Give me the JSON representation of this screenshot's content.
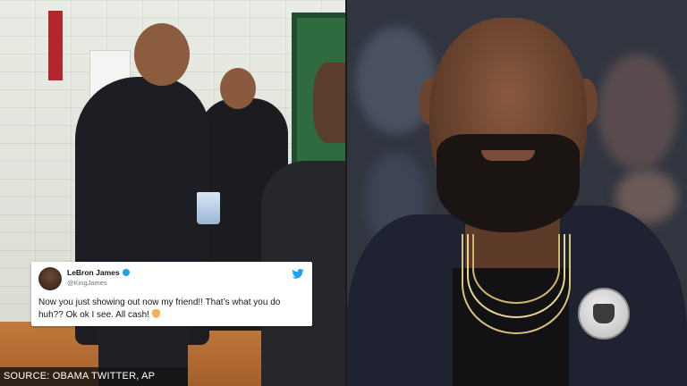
{
  "tweet": {
    "name": "LeBron James",
    "handle": "@KingJames",
    "text": "Now you just showing out now my friend!! That’s what you do huh?? Ok ok I see. All cash!",
    "icons": [
      "verified-badge-icon",
      "twitter-bird-icon",
      "ok-hand-emoji-icon"
    ]
  },
  "caption": {
    "source": "SOURCE: OBAMA TWITTER, AP"
  },
  "colors": {
    "twitter_blue": "#1da1f2",
    "caption_bg": "#141414",
    "floor": "#b06a30",
    "door_green": "#2f6b3f"
  }
}
